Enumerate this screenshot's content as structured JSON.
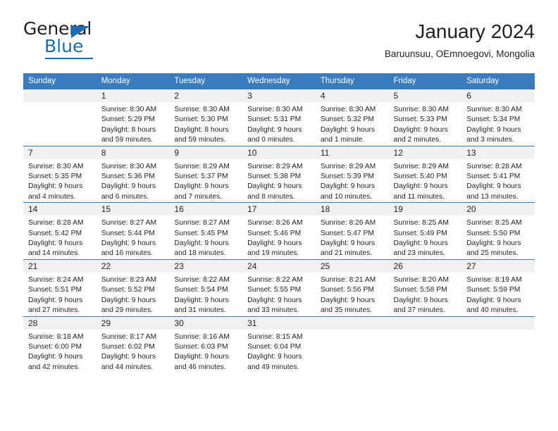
{
  "brand": {
    "name_part1": "General",
    "name_part2": "Blue",
    "accent_color": "#1c6cb5"
  },
  "header": {
    "title": "January 2024",
    "subtitle": "Baruunsuu, OEmnoegovi, Mongolia"
  },
  "calendar": {
    "header_color": "#3a7cbe",
    "daynum_bg": "#f0f0f0",
    "weekday_headers": [
      "Sunday",
      "Monday",
      "Tuesday",
      "Wednesday",
      "Thursday",
      "Friday",
      "Saturday"
    ],
    "weeks": [
      [
        {
          "day": "",
          "lines": []
        },
        {
          "day": "1",
          "lines": [
            "Sunrise: 8:30 AM",
            "Sunset: 5:29 PM",
            "Daylight: 8 hours",
            "and 59 minutes."
          ]
        },
        {
          "day": "2",
          "lines": [
            "Sunrise: 8:30 AM",
            "Sunset: 5:30 PM",
            "Daylight: 8 hours",
            "and 59 minutes."
          ]
        },
        {
          "day": "3",
          "lines": [
            "Sunrise: 8:30 AM",
            "Sunset: 5:31 PM",
            "Daylight: 9 hours",
            "and 0 minutes."
          ]
        },
        {
          "day": "4",
          "lines": [
            "Sunrise: 8:30 AM",
            "Sunset: 5:32 PM",
            "Daylight: 9 hours",
            "and 1 minute."
          ]
        },
        {
          "day": "5",
          "lines": [
            "Sunrise: 8:30 AM",
            "Sunset: 5:33 PM",
            "Daylight: 9 hours",
            "and 2 minutes."
          ]
        },
        {
          "day": "6",
          "lines": [
            "Sunrise: 8:30 AM",
            "Sunset: 5:34 PM",
            "Daylight: 9 hours",
            "and 3 minutes."
          ]
        }
      ],
      [
        {
          "day": "7",
          "lines": [
            "Sunrise: 8:30 AM",
            "Sunset: 5:35 PM",
            "Daylight: 9 hours",
            "and 4 minutes."
          ]
        },
        {
          "day": "8",
          "lines": [
            "Sunrise: 8:30 AM",
            "Sunset: 5:36 PM",
            "Daylight: 9 hours",
            "and 6 minutes."
          ]
        },
        {
          "day": "9",
          "lines": [
            "Sunrise: 8:29 AM",
            "Sunset: 5:37 PM",
            "Daylight: 9 hours",
            "and 7 minutes."
          ]
        },
        {
          "day": "10",
          "lines": [
            "Sunrise: 8:29 AM",
            "Sunset: 5:38 PM",
            "Daylight: 9 hours",
            "and 8 minutes."
          ]
        },
        {
          "day": "11",
          "lines": [
            "Sunrise: 8:29 AM",
            "Sunset: 5:39 PM",
            "Daylight: 9 hours",
            "and 10 minutes."
          ]
        },
        {
          "day": "12",
          "lines": [
            "Sunrise: 8:29 AM",
            "Sunset: 5:40 PM",
            "Daylight: 9 hours",
            "and 11 minutes."
          ]
        },
        {
          "day": "13",
          "lines": [
            "Sunrise: 8:28 AM",
            "Sunset: 5:41 PM",
            "Daylight: 9 hours",
            "and 13 minutes."
          ]
        }
      ],
      [
        {
          "day": "14",
          "lines": [
            "Sunrise: 8:28 AM",
            "Sunset: 5:42 PM",
            "Daylight: 9 hours",
            "and 14 minutes."
          ]
        },
        {
          "day": "15",
          "lines": [
            "Sunrise: 8:27 AM",
            "Sunset: 5:44 PM",
            "Daylight: 9 hours",
            "and 16 minutes."
          ]
        },
        {
          "day": "16",
          "lines": [
            "Sunrise: 8:27 AM",
            "Sunset: 5:45 PM",
            "Daylight: 9 hours",
            "and 18 minutes."
          ]
        },
        {
          "day": "17",
          "lines": [
            "Sunrise: 8:26 AM",
            "Sunset: 5:46 PM",
            "Daylight: 9 hours",
            "and 19 minutes."
          ]
        },
        {
          "day": "18",
          "lines": [
            "Sunrise: 8:26 AM",
            "Sunset: 5:47 PM",
            "Daylight: 9 hours",
            "and 21 minutes."
          ]
        },
        {
          "day": "19",
          "lines": [
            "Sunrise: 8:25 AM",
            "Sunset: 5:49 PM",
            "Daylight: 9 hours",
            "and 23 minutes."
          ]
        },
        {
          "day": "20",
          "lines": [
            "Sunrise: 8:25 AM",
            "Sunset: 5:50 PM",
            "Daylight: 9 hours",
            "and 25 minutes."
          ]
        }
      ],
      [
        {
          "day": "21",
          "lines": [
            "Sunrise: 8:24 AM",
            "Sunset: 5:51 PM",
            "Daylight: 9 hours",
            "and 27 minutes."
          ]
        },
        {
          "day": "22",
          "lines": [
            "Sunrise: 8:23 AM",
            "Sunset: 5:52 PM",
            "Daylight: 9 hours",
            "and 29 minutes."
          ]
        },
        {
          "day": "23",
          "lines": [
            "Sunrise: 8:22 AM",
            "Sunset: 5:54 PM",
            "Daylight: 9 hours",
            "and 31 minutes."
          ]
        },
        {
          "day": "24",
          "lines": [
            "Sunrise: 8:22 AM",
            "Sunset: 5:55 PM",
            "Daylight: 9 hours",
            "and 33 minutes."
          ]
        },
        {
          "day": "25",
          "lines": [
            "Sunrise: 8:21 AM",
            "Sunset: 5:56 PM",
            "Daylight: 9 hours",
            "and 35 minutes."
          ]
        },
        {
          "day": "26",
          "lines": [
            "Sunrise: 8:20 AM",
            "Sunset: 5:58 PM",
            "Daylight: 9 hours",
            "and 37 minutes."
          ]
        },
        {
          "day": "27",
          "lines": [
            "Sunrise: 8:19 AM",
            "Sunset: 5:59 PM",
            "Daylight: 9 hours",
            "and 40 minutes."
          ]
        }
      ],
      [
        {
          "day": "28",
          "lines": [
            "Sunrise: 8:18 AM",
            "Sunset: 6:00 PM",
            "Daylight: 9 hours",
            "and 42 minutes."
          ]
        },
        {
          "day": "29",
          "lines": [
            "Sunrise: 8:17 AM",
            "Sunset: 6:02 PM",
            "Daylight: 9 hours",
            "and 44 minutes."
          ]
        },
        {
          "day": "30",
          "lines": [
            "Sunrise: 8:16 AM",
            "Sunset: 6:03 PM",
            "Daylight: 9 hours",
            "and 46 minutes."
          ]
        },
        {
          "day": "31",
          "lines": [
            "Sunrise: 8:15 AM",
            "Sunset: 6:04 PM",
            "Daylight: 9 hours",
            "and 49 minutes."
          ]
        },
        {
          "day": "",
          "lines": []
        },
        {
          "day": "",
          "lines": []
        },
        {
          "day": "",
          "lines": []
        }
      ]
    ]
  }
}
